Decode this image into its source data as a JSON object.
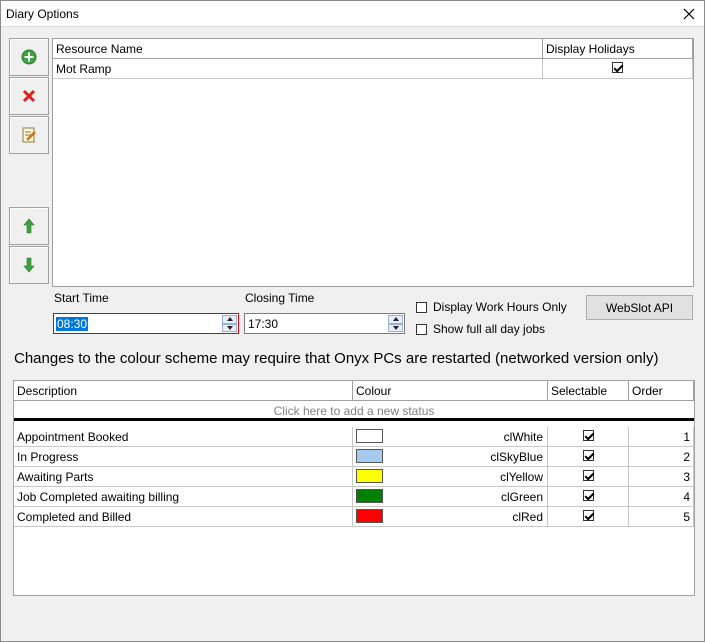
{
  "window": {
    "title": "Diary Options"
  },
  "resources": {
    "columns": [
      "Resource Name",
      "Display Holidays"
    ],
    "rows": [
      {
        "name": "Mot Ramp",
        "display_holidays": true
      }
    ]
  },
  "times": {
    "start_label": "Start Time",
    "start_value": "08:30",
    "closing_label": "Closing Time",
    "closing_value": "17:30"
  },
  "options": {
    "work_hours_label": "Display Work Hours Only",
    "work_hours_checked": false,
    "all_day_label": "Show full all day jobs",
    "all_day_checked": false
  },
  "webslot_label": "WebSlot API",
  "notice": "Changes to the colour scheme may require that Onyx PCs are restarted (networked version only)",
  "statuses": {
    "columns": [
      "Description",
      "Colour",
      "Selectable",
      "Order"
    ],
    "add_prompt": "Click here to add a new status",
    "rows": [
      {
        "description": "Appointment Booked",
        "colour_name": "clWhite",
        "colour": "#ffffff",
        "selectable": true,
        "order": "1"
      },
      {
        "description": "In Progress",
        "colour_name": "clSkyBlue",
        "colour": "#a6caf0",
        "selectable": true,
        "order": "2"
      },
      {
        "description": "Awaiting Parts",
        "colour_name": "clYellow",
        "colour": "#ffff00",
        "selectable": true,
        "order": "3"
      },
      {
        "description": "Job Completed awaiting billing",
        "colour_name": "clGreen",
        "colour": "#008000",
        "selectable": true,
        "order": "4"
      },
      {
        "description": "Completed and Billed",
        "colour_name": "clRed",
        "colour": "#ff0000",
        "selectable": true,
        "order": "5"
      }
    ]
  },
  "toolbar_icons": [
    "add-icon",
    "delete-icon",
    "edit-icon",
    "move-up-icon",
    "move-down-icon"
  ]
}
